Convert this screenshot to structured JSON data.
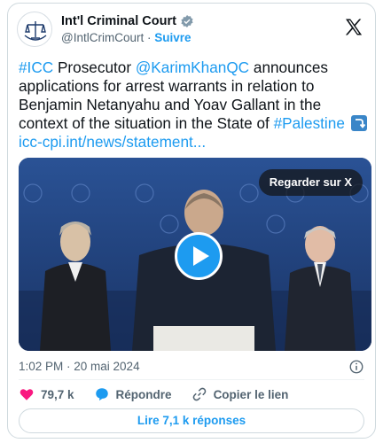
{
  "account": {
    "display_name": "Int'l Criminal Court",
    "handle": "@IntlCrimCourt",
    "separator": "·",
    "follow_label": "Suivre"
  },
  "tweet": {
    "hashtag_icc": "#ICC",
    "text_1": " Prosecutor ",
    "mention": "@KarimKhanQC",
    "text_2": " announces applications for arrest warrants in relation to Benjamin Netanyahu and Yoav Gallant in the context of the situation in the State of ",
    "hashtag_palestine": "#Palestine",
    "link": "icc-cpi.int/news/statement..."
  },
  "media": {
    "watch_label": "Regarder sur X",
    "play_icon": "play-icon"
  },
  "meta": {
    "timestamp": "1:02 PM · 20 mai 2024"
  },
  "actions": {
    "likes": "79,7 k",
    "reply_label": "Répondre",
    "copy_label": "Copier le lien"
  },
  "replies_button": "Lire 7,1 k réponses",
  "colors": {
    "link": "#1d9bf0",
    "like": "#f91880",
    "secondary": "#536471"
  }
}
